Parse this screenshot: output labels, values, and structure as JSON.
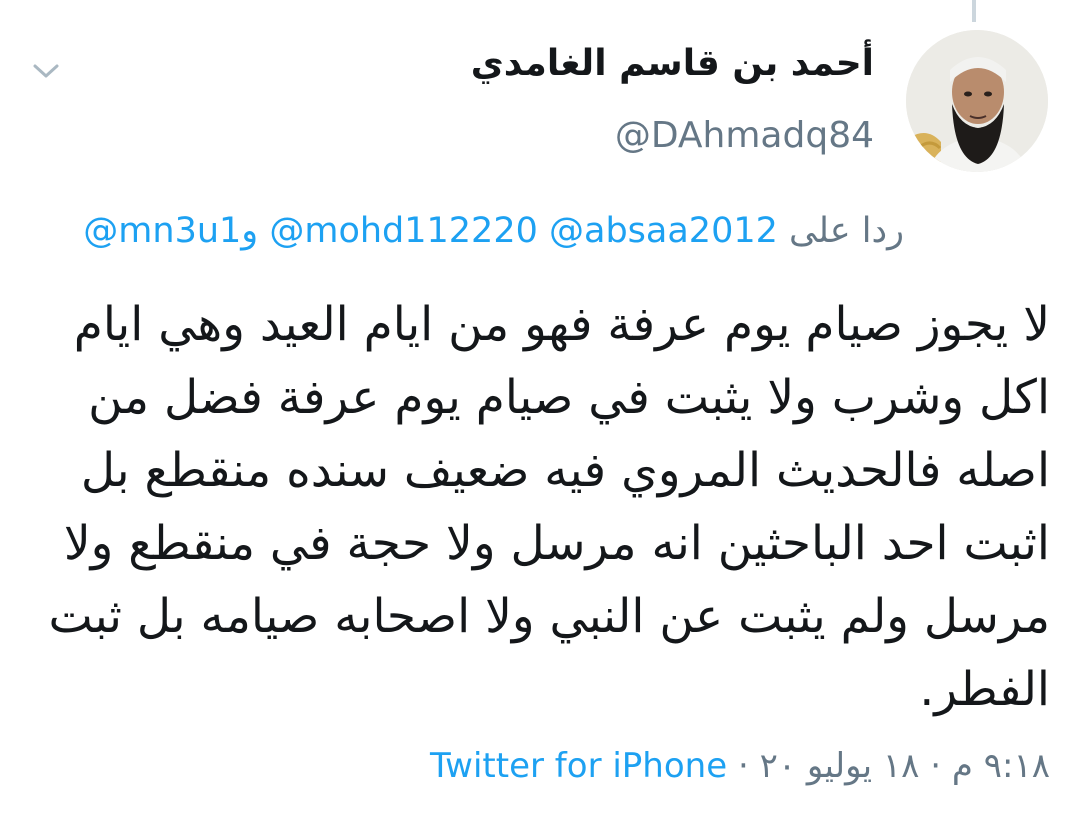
{
  "tweet": {
    "author": {
      "display_name": "أحمد بن قاسم الغامدي",
      "handle": "@DAhmadq84",
      "avatar_icon": "profile-photo"
    },
    "menu_icon": "chevron-down-icon",
    "reply": {
      "prefix": "ردا على",
      "mentions": [
        "@absaa2012",
        "@mohd112220",
        "@mn3u1"
      ],
      "conjunction": "و"
    },
    "text": "لا يجوز صيام يوم عرفة فهو من ايام العيد وهي ايام اكل وشرب ولا يثبت في صيام يوم عرفة فضل من اصله فالحديث المروي فيه ضعيف سنده منقطع بل اثبت احد الباحثين انه مرسل ولا حجة في منقطع ولا مرسل ولم يثبت عن النبي ولا اصحابه صيامه بل ثبت الفطر.",
    "meta": {
      "time": "٩:١٨ م",
      "date": "١٨ يوليو ٢٠",
      "separator": "·",
      "source": "Twitter for iPhone"
    }
  },
  "colors": {
    "link": "#1da1f2",
    "secondary_text": "#657786",
    "primary_text": "#14171a",
    "thread_line": "#ccd6dd"
  }
}
